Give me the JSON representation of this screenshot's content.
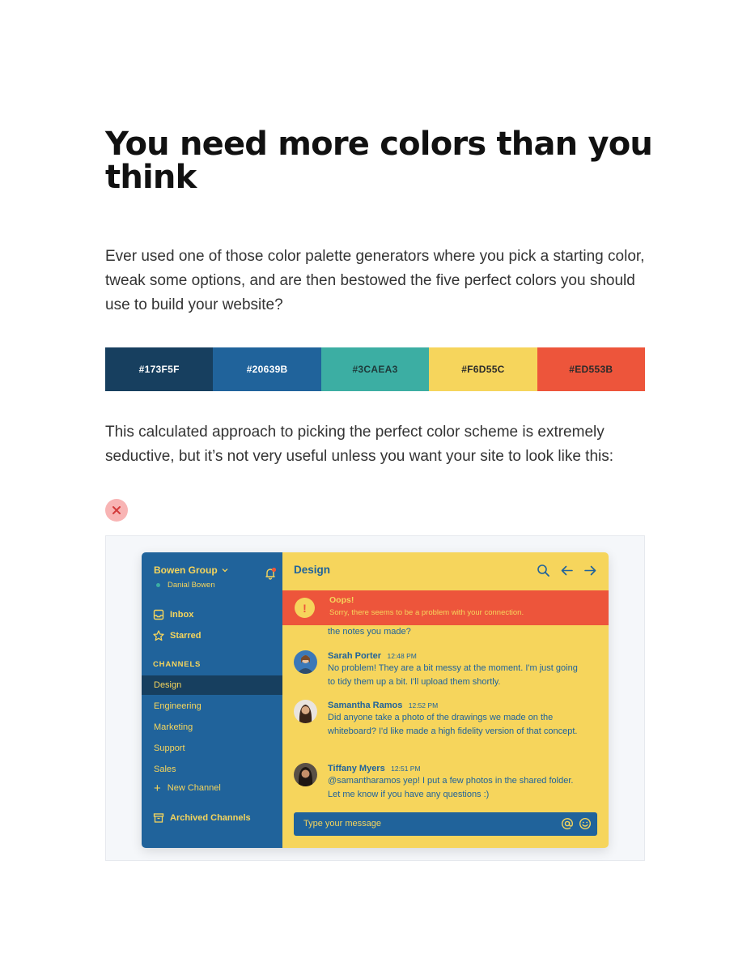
{
  "article": {
    "title": "You need more colors than you think",
    "paragraph_1": "Ever used one of those color palette generators where you pick a starting color, tweak some options, and are then bestowed the five perfect colors you should use to build your website?",
    "paragraph_2": "This calculated approach to picking the perfect color scheme is extremely seductive, but it’s not very useful unless you want your site to look like this:"
  },
  "palette": [
    {
      "label": "#173F5F",
      "color": "#173F5F",
      "text_color": "#FFFFFF"
    },
    {
      "label": "#20639B",
      "color": "#20639B",
      "text_color": "#FFFFFF"
    },
    {
      "label": "#3CAEA3",
      "color": "#3CAEA3",
      "text_color": "#1E3A3A"
    },
    {
      "label": "#F6D55C",
      "color": "#F6D55C",
      "text_color": "#2B2B2B"
    },
    {
      "label": "#ED553B",
      "color": "#ED553B",
      "text_color": "#2B2B2B"
    }
  ],
  "badge": {
    "icon": "close-icon",
    "color": "#F8B4B4",
    "mark_color": "#D33B3B"
  },
  "chat_app": {
    "sidebar": {
      "group_name": "Bowen Group",
      "user_name": "Danial Bowen",
      "inbox_label": "Inbox",
      "starred_label": "Starred",
      "channels_heading": "CHANNELS",
      "channels": [
        "Design",
        "Engineering",
        "Marketing",
        "Support",
        "Sales"
      ],
      "active_channel": "Design",
      "new_channel_label": "New Channel",
      "archived_label": "Archived Channels"
    },
    "main": {
      "title": "Design",
      "alert_title": "Oops!",
      "alert_message": "Sorry, there seems to be a problem with your connection.",
      "cut_message": "the notes you made?",
      "messages": [
        {
          "author": "Sarah Porter",
          "time": "12:48 PM",
          "text": "No problem! They are a bit messy at the moment. I'm just going to tidy them up a bit. I'll upload them shortly."
        },
        {
          "author": "Samantha Ramos",
          "time": "12:52 PM",
          "text": "Did anyone take a photo of the drawings we made on the whiteboard? I'd like made a high fidelity version of that concept."
        },
        {
          "author": "Tiffany Myers",
          "time": "12:51 PM",
          "text": "@samantharamos yep! I put a few photos in the shared folder. Let me know if you have any questions :)"
        }
      ],
      "composer_placeholder": "Type your message"
    },
    "colors": {
      "dark": "#173F5F",
      "blue": "#20639B",
      "teal": "#3CAEA3",
      "yellow": "#F6D55C",
      "red": "#ED553B"
    }
  }
}
